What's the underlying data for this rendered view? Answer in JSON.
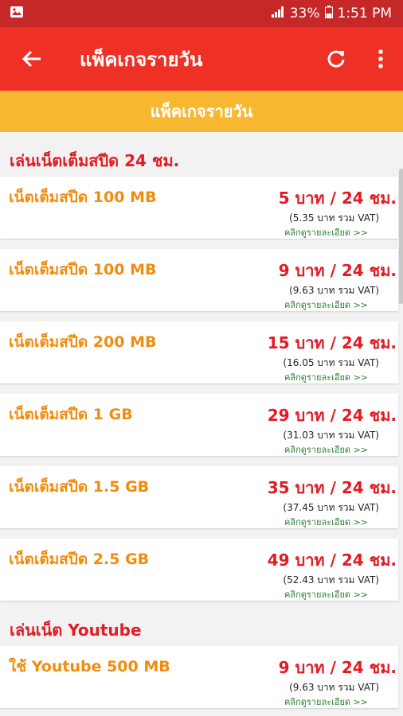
{
  "status_bar": {
    "battery": "33%",
    "time": "1:51 PM"
  },
  "app_bar": {
    "title": "แพ็คเกจรายวัน",
    "back_icon": "arrow-back-icon",
    "refresh_icon": "refresh-icon",
    "menu_icon": "more-vert-icon"
  },
  "sub_header": "แพ็คเกจรายวัน",
  "sections": [
    {
      "title": "เล่นเน็ตเต็มสปีด 24 ชม.",
      "items": [
        {
          "name": "เน็ตเต็มสปีด 100 MB",
          "price": "5 บาท / 24 ชม.",
          "vat": "(5.35 บาท รวม VAT)",
          "detail": "คลิกดูรายละเอียด >>"
        },
        {
          "name": "เน็ตเต็มสปีด 100 MB",
          "price": "9 บาท / 24 ชม.",
          "vat": "(9.63 บาท รวม VAT)",
          "detail": "คลิกดูรายละเอียด >>"
        },
        {
          "name": "เน็ตเต็มสปีด 200 MB",
          "price": "15 บาท / 24 ชม.",
          "vat": "(16.05 บาท รวม VAT)",
          "detail": "คลิกดูรายละเอียด >>"
        },
        {
          "name": "เน็ตเต็มสปีด 1 GB",
          "price": "29 บาท / 24 ชม.",
          "vat": "(31.03 บาท รวม VAT)",
          "detail": "คลิกดูรายละเอียด >>"
        },
        {
          "name": "เน็ตเต็มสปีด 1.5 GB",
          "price": "35 บาท / 24 ชม.",
          "vat": "(37.45 บาท รวม VAT)",
          "detail": "คลิกดูรายละเอียด >>"
        },
        {
          "name": "เน็ตเต็มสปีด 2.5 GB",
          "price": "49 บาท / 24 ชม.",
          "vat": "(52.43 บาท รวม VAT)",
          "detail": "คลิกดูรายละเอียด >>"
        }
      ]
    },
    {
      "title": "เล่นเน็ต Youtube",
      "items": [
        {
          "name": "ใช้ Youtube 500 MB",
          "price": "9 บาท / 24 ชม.",
          "vat": "(9.63 บาท รวม VAT)",
          "detail": "คลิกดูรายละเอียด >>"
        }
      ]
    }
  ],
  "colors": {
    "app_bar": "#ee3124",
    "status_bar": "#c62828",
    "sub_header": "#f7b731",
    "price": "#e31b23",
    "name": "#f28c0e",
    "detail": "#2e7d32"
  }
}
